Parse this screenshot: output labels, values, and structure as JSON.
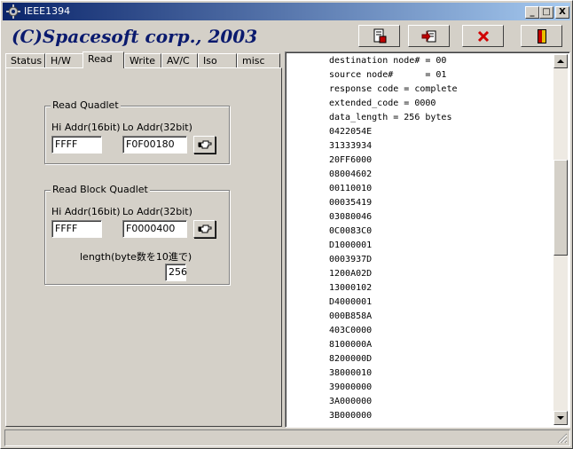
{
  "window": {
    "title": "IEEE1394"
  },
  "titlebar_buttons": {
    "minimize": "_",
    "maximize": "□",
    "close": "X"
  },
  "header": {
    "title": "(C)Spacesoft corp., 2003"
  },
  "toolbar": {
    "buttons": [
      {
        "name": "save-log-button",
        "icon": "document-save-icon"
      },
      {
        "name": "copy-log-button",
        "icon": "document-copy-icon"
      },
      {
        "name": "clear-button",
        "icon": "red-x-icon"
      },
      {
        "name": "exit-button",
        "icon": "door-exit-icon"
      }
    ]
  },
  "tabs": [
    "Status",
    "H/W",
    "Read",
    "Write",
    "AV/C",
    "Iso",
    "misc"
  ],
  "active_tab": "Read",
  "read_quadlet": {
    "title": "Read Quadlet",
    "hi_label": "Hi Addr(16bit)",
    "lo_label": "Lo Addr(32bit)",
    "hi_value": "FFFF",
    "lo_value": "F0F00180"
  },
  "read_block": {
    "title": "Read Block Quadlet",
    "hi_label": "Hi Addr(16bit)",
    "lo_label": "Lo Addr(32bit)",
    "hi_value": "FFFF",
    "lo_value": "F0000400",
    "length_label": "length(byte数を10進で)",
    "length_value": "256"
  },
  "log": {
    "lines": [
      "destination node# = 00",
      "source node#      = 01",
      "response code = complete",
      "extended_code = 0000",
      "data_length = 256 bytes",
      "0422054E",
      "31333934",
      "20FF6000",
      "08004602",
      "00110010",
      "00035419",
      "03080046",
      "0C0083C0",
      "D1000001",
      "0003937D",
      "1200A02D",
      "13000102",
      "D4000001",
      "000B858A",
      "403C0000",
      "8100000A",
      "8200000D",
      "38000010",
      "39000000",
      "3A000000",
      "3B000000"
    ]
  },
  "colors": {
    "titlebar_start": "#0a246a",
    "titlebar_end": "#a6caf0",
    "header_text": "#0a1a6e",
    "face": "#d4d0c8"
  }
}
